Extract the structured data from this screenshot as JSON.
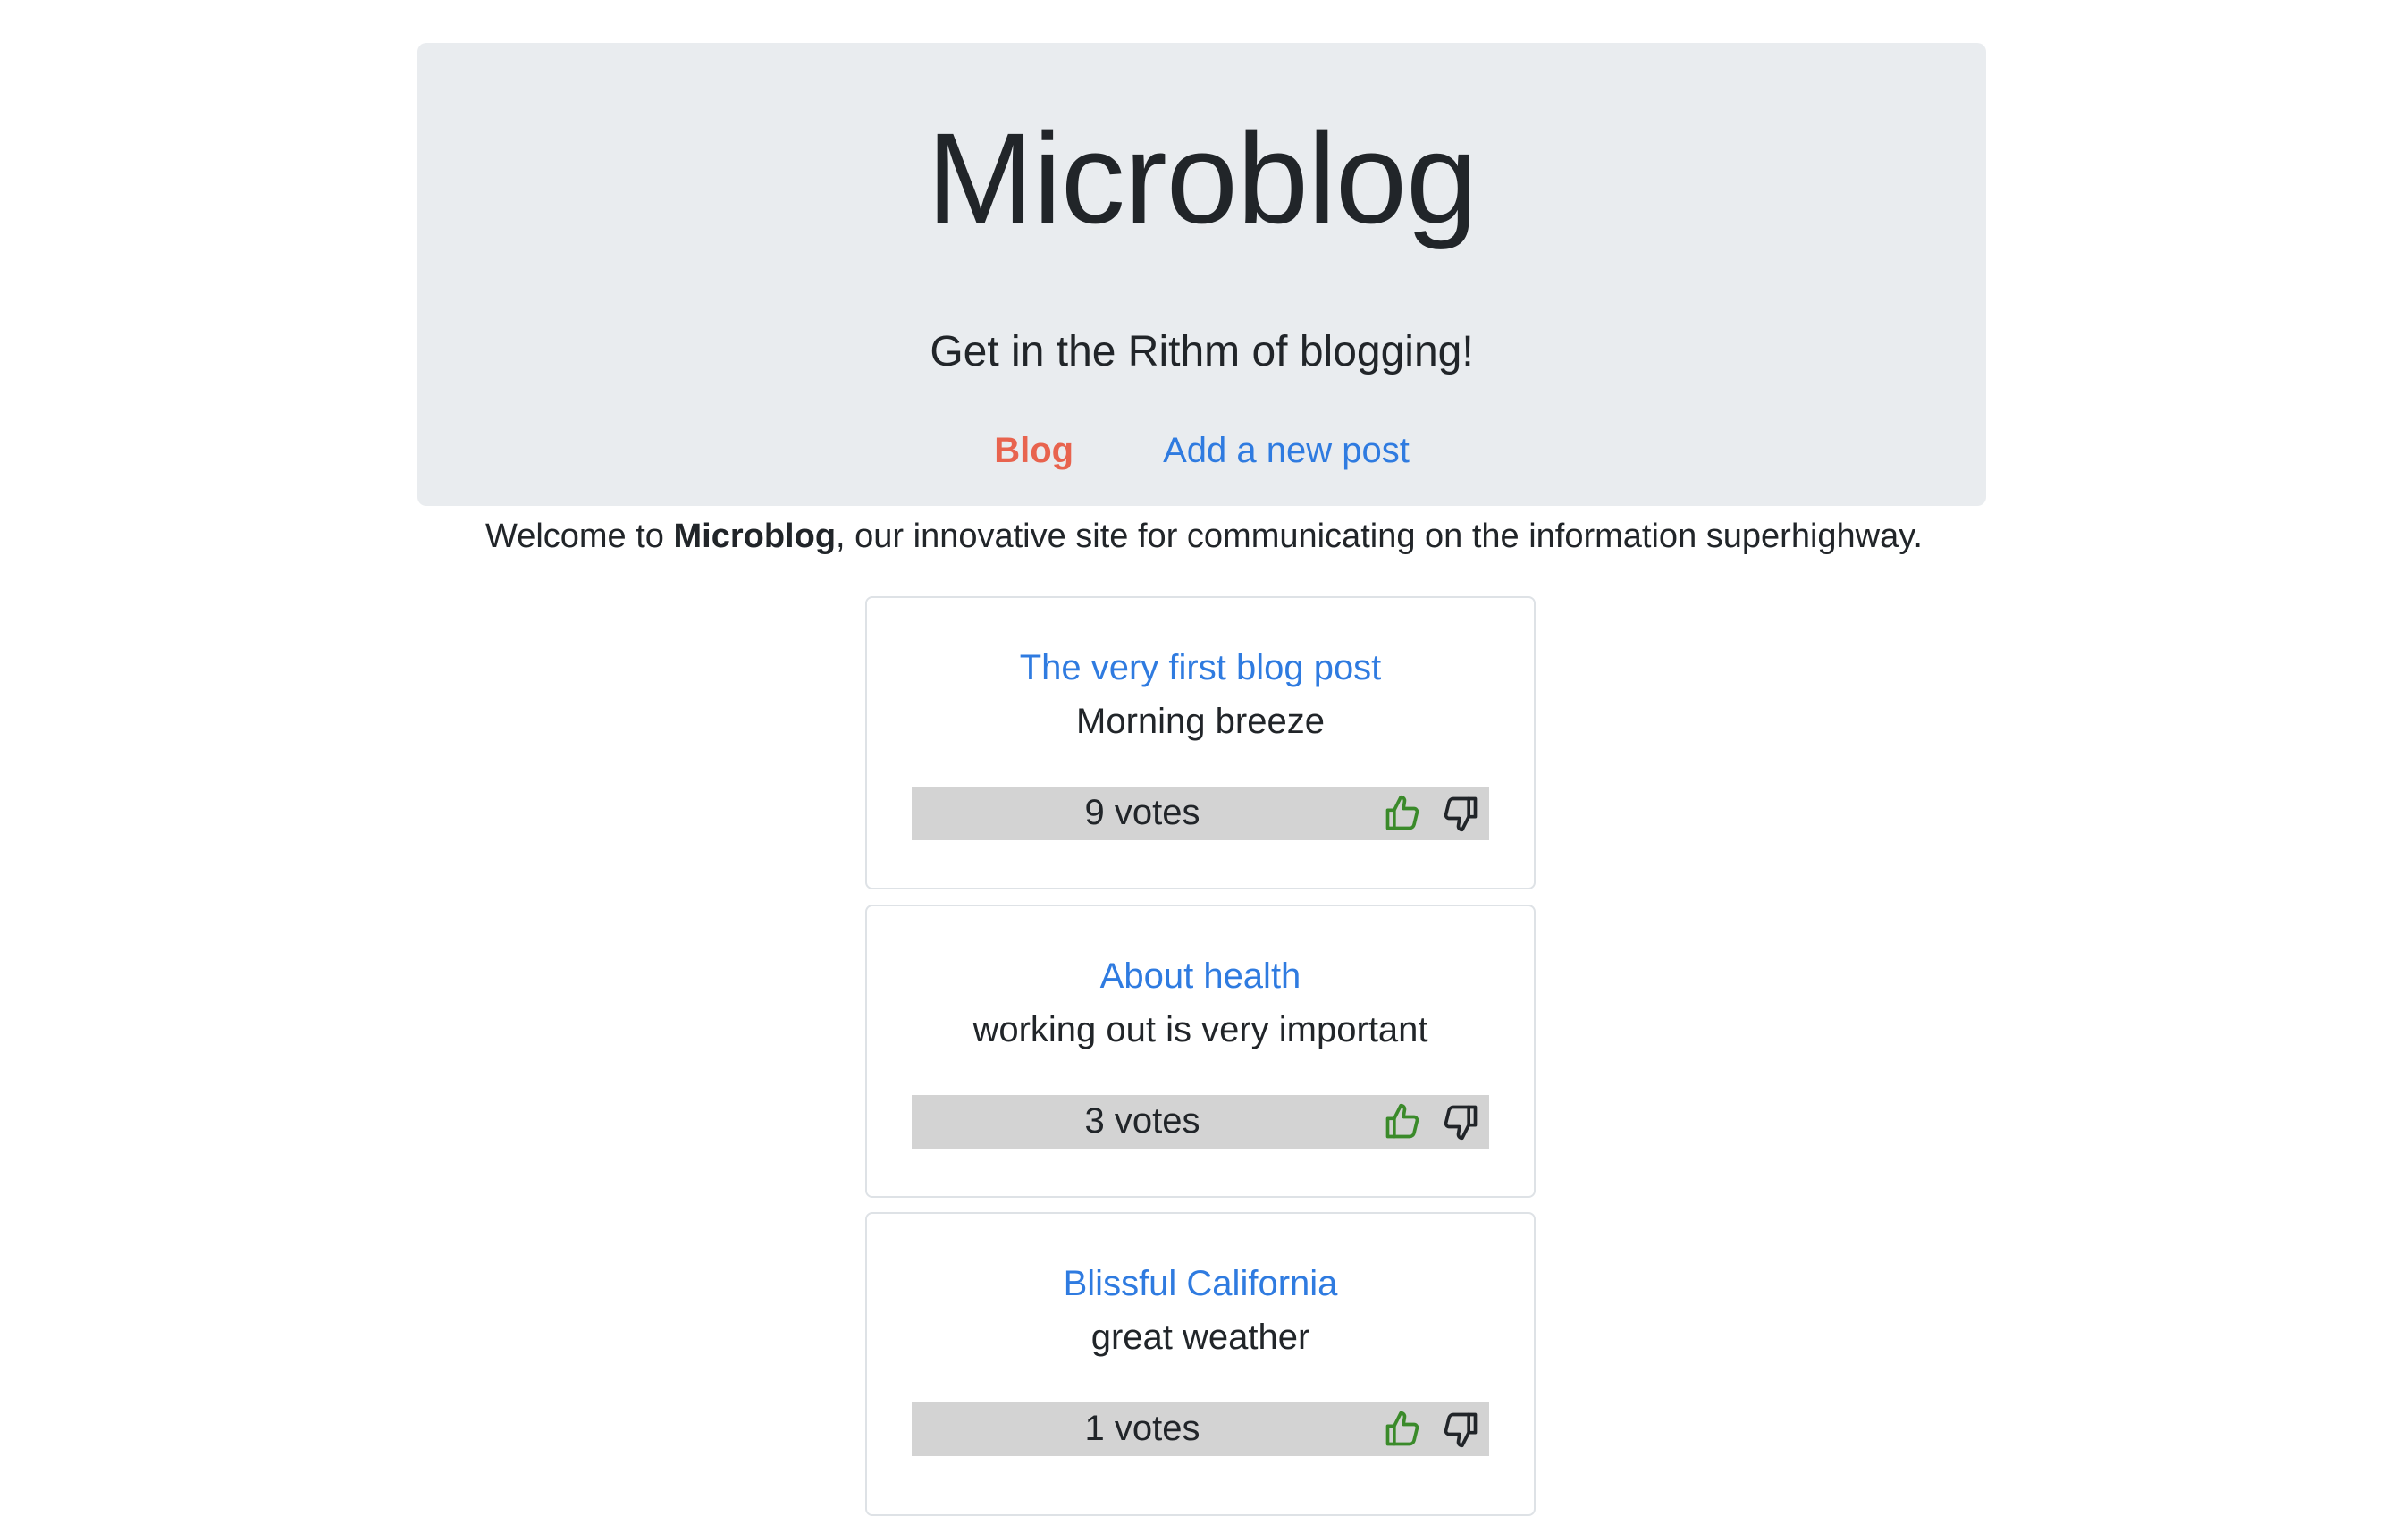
{
  "header": {
    "title": "Microblog",
    "subtitle": "Get in the Rithm of blogging!",
    "nav": {
      "blog": "Blog",
      "new_post": "Add a new post"
    }
  },
  "welcome": {
    "prefix": "Welcome to ",
    "brand": "Microblog",
    "suffix": ", our innovative site for communicating on the information superhighway."
  },
  "colors": {
    "active_nav": "#e8634e",
    "link": "#2f7be0",
    "vote_bar": "#d3d3d3",
    "thumbs_up": "#3a8a2a",
    "thumbs_down": "#212529"
  },
  "icons": {
    "upvote": "thumbs-up-icon",
    "downvote": "thumbs-down-icon"
  },
  "posts": [
    {
      "title": "The very first blog post",
      "body": "Morning breeze",
      "votes": "9 votes"
    },
    {
      "title": "About health",
      "body": "working out is very important",
      "votes": "3 votes"
    },
    {
      "title": "Blissful California",
      "body": "great weather",
      "votes": "1 votes"
    }
  ]
}
